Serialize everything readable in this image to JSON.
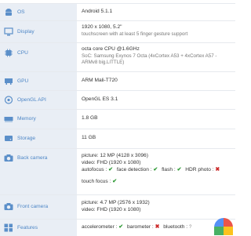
{
  "rows": [
    {
      "label": "OS",
      "icon": "android-icon",
      "lines": [
        "Android 5.1.1"
      ]
    },
    {
      "label": "Display",
      "icon": "display-icon",
      "lines": [
        "1920 x 1080, 5.2\"",
        "touchscreen with at least 5 finger gesture support"
      ]
    },
    {
      "label": "CPU",
      "icon": "cpu-icon",
      "lines": [
        "octa core CPU @1.6GHz",
        "SoC: Samsung Exynos 7 Octa (4xCortex A53 + 4xCortex A57 - ARMv8 big.LITTLE)"
      ]
    },
    {
      "label": "GPU",
      "icon": "gpu-icon",
      "lines": [
        "ARM Mali-T720"
      ]
    },
    {
      "label": "OpenGL API",
      "icon": "opengl-icon",
      "lines": [
        "OpenGL ES 3.1"
      ]
    },
    {
      "label": "Memory",
      "icon": "memory-icon",
      "lines": [
        "1.8 GB"
      ]
    },
    {
      "label": "Storage",
      "icon": "storage-icon",
      "lines": [
        "11 GB"
      ]
    },
    {
      "label": "Back camera",
      "icon": "camera-icon",
      "lines": [
        "picture: 12 MP (4128 x 3096)",
        "video: FHD (1920 x 1080)"
      ],
      "features": [
        {
          "name": "autofocus :",
          "status": "yes"
        },
        {
          "name": "face detection :",
          "status": "yes"
        },
        {
          "name": "flash :",
          "status": "yes"
        },
        {
          "name": "HDR photo :",
          "status": "no"
        },
        {
          "name": "touch focus :",
          "status": "yes"
        }
      ]
    },
    {
      "label": "Front camera",
      "icon": "front-camera-icon",
      "lines": [
        "picture: 4.7 MP (2576 x 1932)",
        "video: FHD (1920 x 1080)"
      ]
    },
    {
      "label": "Features",
      "icon": "features-icon",
      "lines": [],
      "features": [
        {
          "name": "accelerometer :",
          "status": "yes"
        },
        {
          "name": "barometer :",
          "status": "no"
        },
        {
          "name": "bluetooth :",
          "status": "unknown"
        }
      ]
    }
  ],
  "symbols": {
    "yes": "✔",
    "no": "✖",
    "unknown": "?"
  },
  "colors": {
    "label_text": "#4d86c6",
    "label_bg": "#e9eef5",
    "check": "#2f9a36",
    "cross": "#cc2a2a"
  }
}
